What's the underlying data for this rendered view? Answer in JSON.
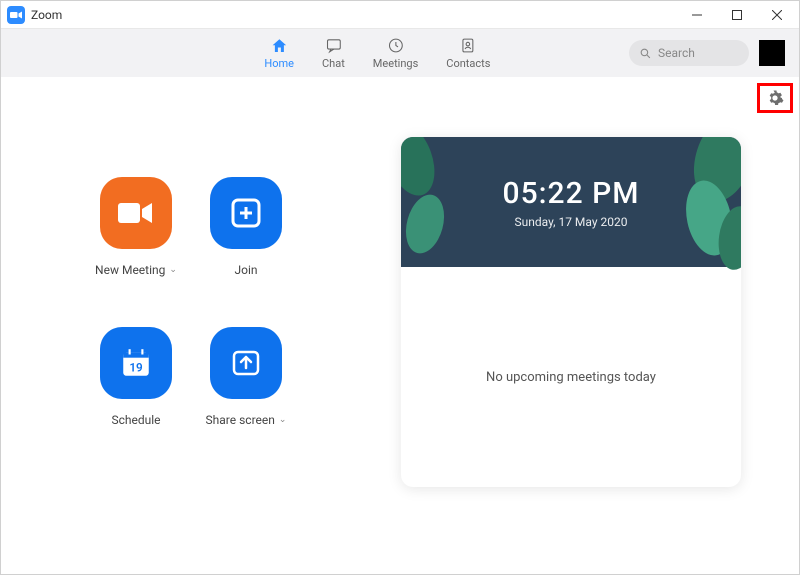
{
  "window": {
    "title": "Zoom"
  },
  "nav": {
    "home": "Home",
    "chat": "Chat",
    "meetings": "Meetings",
    "contacts": "Contacts"
  },
  "search": {
    "placeholder": "Search"
  },
  "actions": {
    "new_meeting": "New Meeting",
    "join": "Join",
    "schedule": "Schedule",
    "share_screen": "Share screen",
    "calendar_day": "19"
  },
  "clock": {
    "time": "05:22 PM",
    "date": "Sunday, 17 May 2020"
  },
  "upcoming": {
    "empty_text": "No upcoming meetings today"
  }
}
